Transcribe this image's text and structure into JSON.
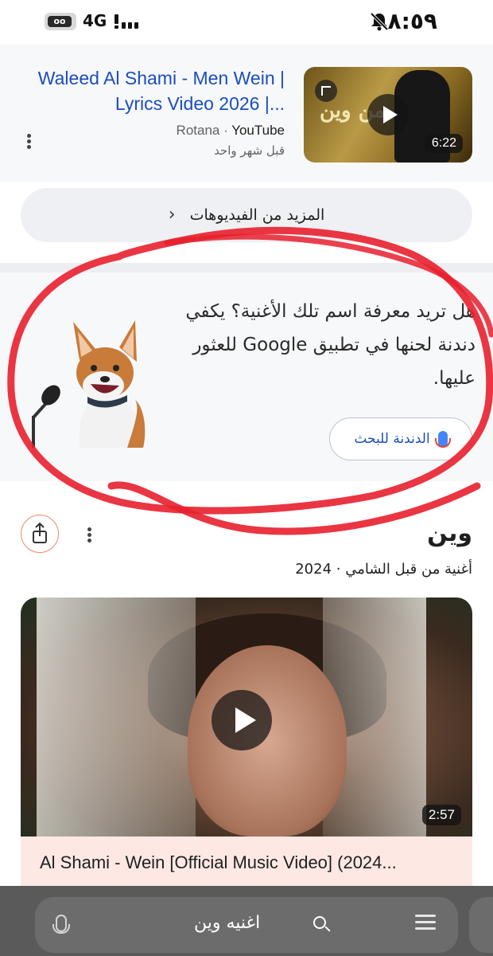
{
  "status_bar": {
    "time": "٨:٥٩",
    "network": "4G",
    "battery_label": "oo"
  },
  "video_result": {
    "title": "Waleed Al Shami - Men Wein | Lyrics Video 2026 |...",
    "source_channel": "Rotana",
    "source_site": "YouTube",
    "age": "قبل شهر واحد",
    "duration": "6:22",
    "thumb_art_text": "من وين"
  },
  "more_videos": {
    "label": "المزيد من الفيديوهات"
  },
  "hum_to_search": {
    "text": "هل تريد معرفة اسم تلك الأغنية؟ يكفي دندنة لحنها في تطبيق Google للعثور عليها.",
    "button_label": "الدندنة للبحث"
  },
  "song": {
    "title": "وين",
    "subtitle": "أغنية من قبل الشامي · 2024"
  },
  "main_video": {
    "title": "Al Shami - Wein [Official Music Video] (2024...",
    "duration": "2:57"
  },
  "search_bar": {
    "query": "اغنيه وين"
  },
  "colors": {
    "link_blue": "#1a4dbd",
    "annotation_red": "#e8202e",
    "caption_bg": "#fde8e4"
  }
}
